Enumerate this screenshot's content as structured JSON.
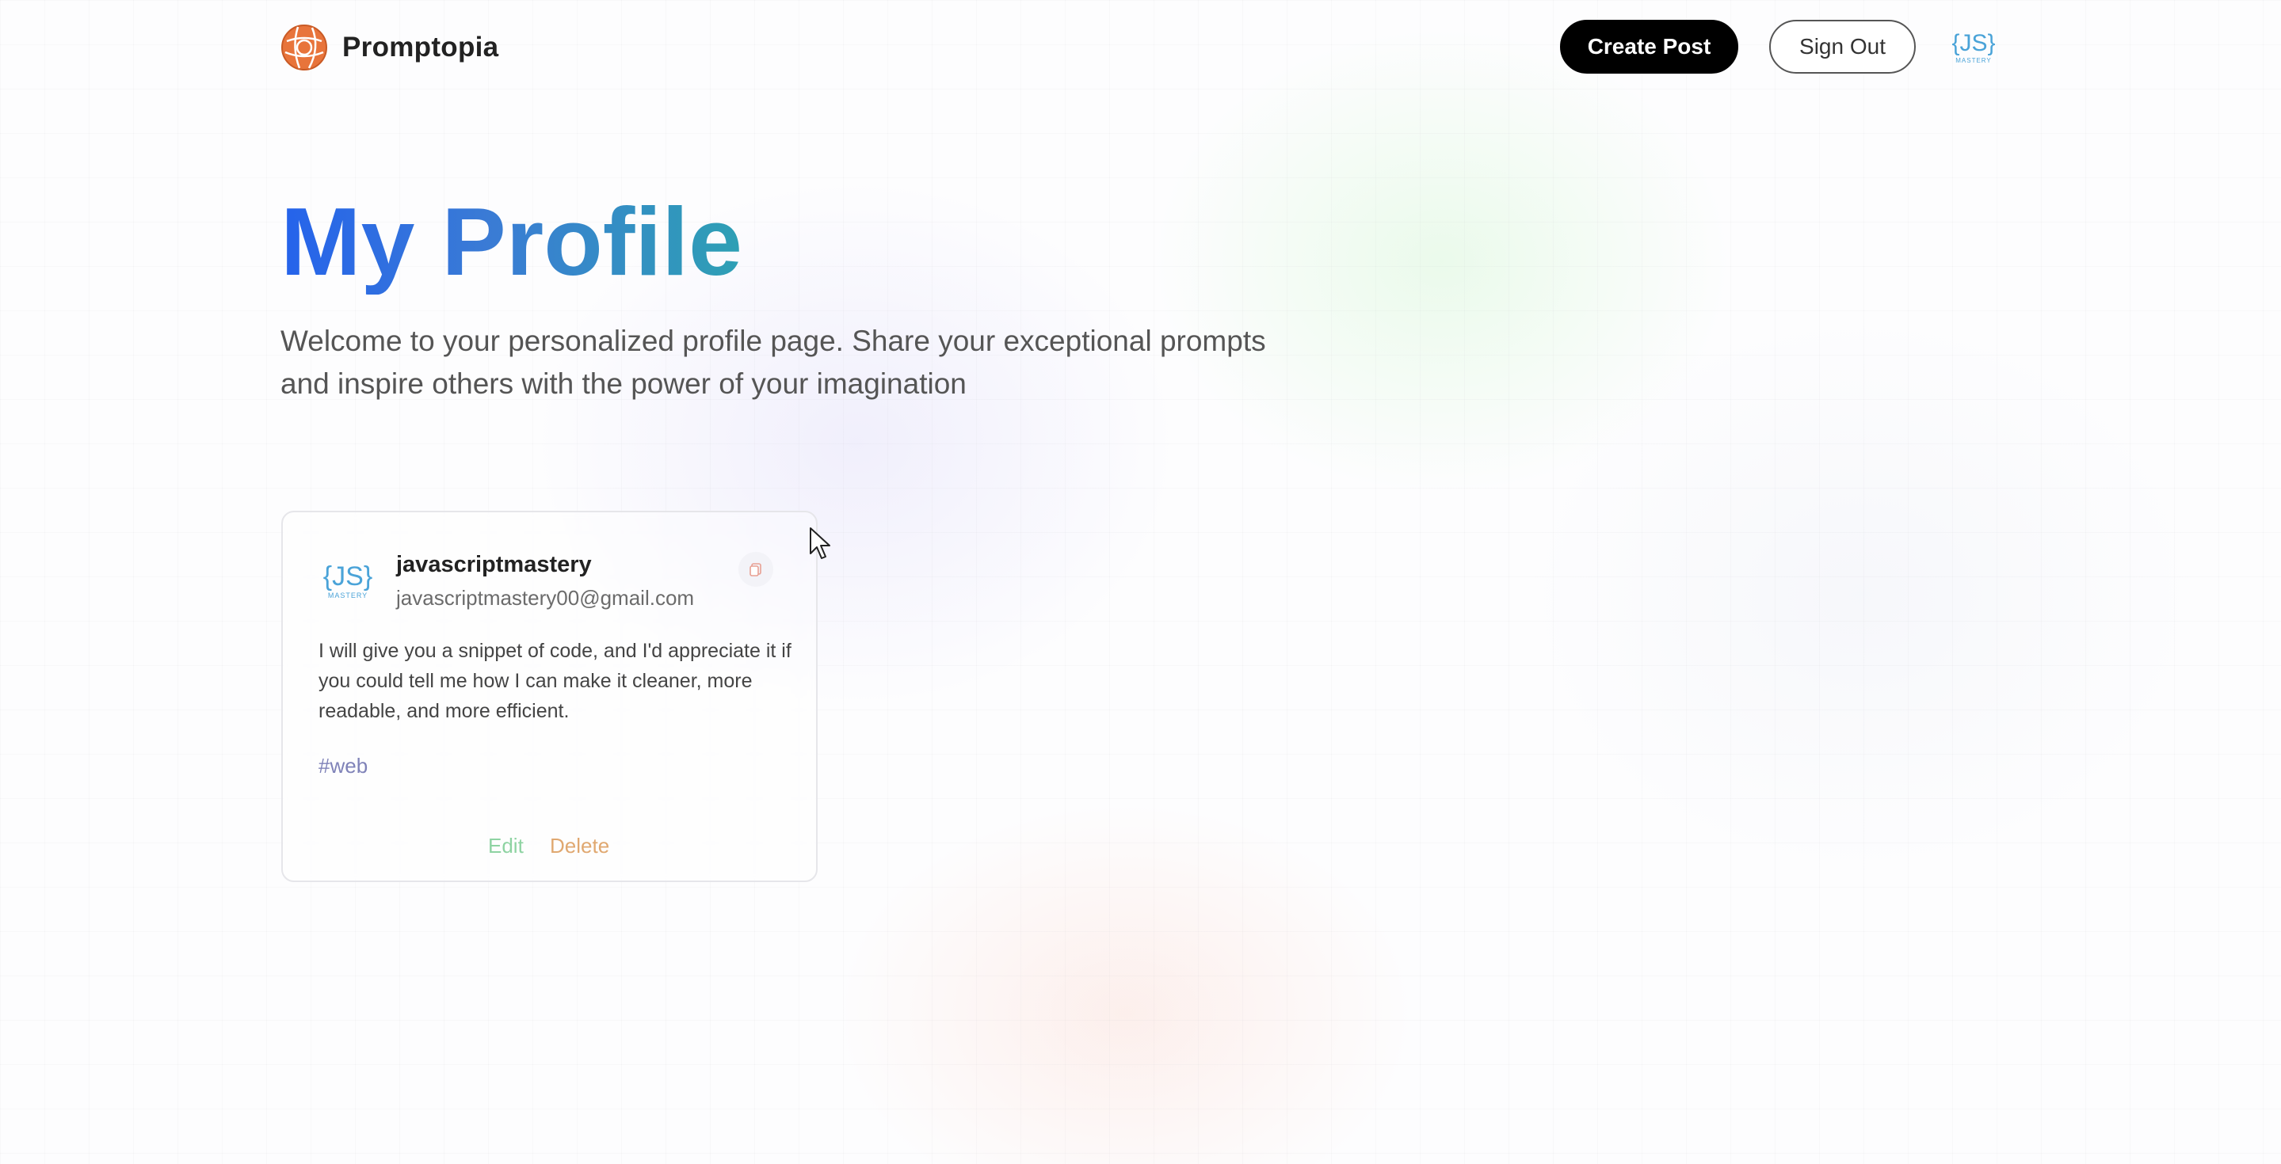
{
  "nav": {
    "logo_icon": "promptopia-logo-icon",
    "logo_text": "Promptopia",
    "create_post_label": "Create Post",
    "sign_out_label": "Sign Out",
    "avatar_logo_text": "{JS}",
    "avatar_logo_subtext": "MASTERY"
  },
  "profile": {
    "title": "My Profile",
    "description": "Welcome to your personalized profile page. Share your exceptional prompts and inspire others with the power of your imagination"
  },
  "posts": [
    {
      "username": "javascriptmastery",
      "email": "javascriptmastery00@gmail.com",
      "avatar_logo_text": "{JS}",
      "avatar_logo_subtext": "MASTERY",
      "copy_icon": "copy-icon",
      "prompt": "I will give you a snippet of code, and I'd appreciate it if you could tell me how I can make it cleaner, more readable, and more efficient.",
      "tag": "#web",
      "edit_label": "Edit",
      "delete_label": "Delete"
    }
  ],
  "colors": {
    "title_gradient_start": "#2563eb",
    "title_gradient_end": "#2ea0b4",
    "primary_button": "#000000",
    "tag": "#7f82b8",
    "edit": "#8ed3a2",
    "delete": "#e0a870",
    "logo_orange": "#e8743b"
  }
}
